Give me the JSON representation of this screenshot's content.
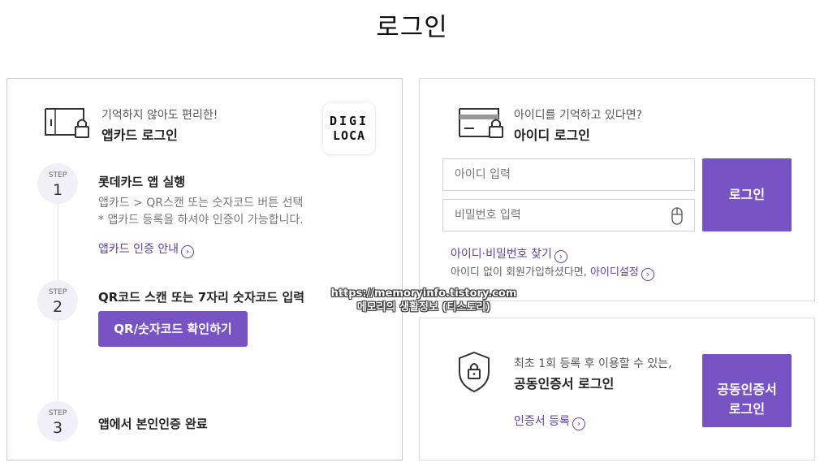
{
  "page": {
    "title": "로그인"
  },
  "app_card_panel": {
    "subtitle": "기억하지 않아도 편리한!",
    "heading": "앱카드 로그인",
    "logo": {
      "line1": "DIGI",
      "line2": "LOCA"
    },
    "step_label": "STEP",
    "steps": [
      {
        "number": "1",
        "title": "롯데카드 앱 실행",
        "desc1": "앱카드 > QR스캔 또는 숫자코드 버튼 선택",
        "desc2": "* 앱카드 등록을 하셔야 인증이 가능합니다.",
        "link": "앱카드 인증 안내"
      },
      {
        "number": "2",
        "title": "QR코드 스캔 또는 7자리 숫자코드 입력",
        "button": "QR/숫자코드 확인하기"
      },
      {
        "number": "3",
        "title": "앱에서 본인인증 완료"
      }
    ]
  },
  "id_panel": {
    "subtitle": "아이디를 기억하고 있다면?",
    "heading": "아이디 로그인",
    "id_placeholder": "아이디 입력",
    "pw_placeholder": "비밀번호 입력",
    "login_button": "로그인",
    "find_link": "아이디·비밀번호 찾기",
    "no_id_text": "아이디 없이 회원가입하셨다면,",
    "id_setup_link": "아이디설정"
  },
  "cert_panel": {
    "subtitle": "최초 1회 등록 후 이용할 수 있는,",
    "heading": "공동인증서 로그인",
    "register_link": "인증서 등록",
    "button_line1": "공동인증서",
    "button_line2": "로그인"
  },
  "watermark": {
    "line1": "https://memoryinfo.tistory.com",
    "line2": "메모리의 생활정보 (티스토리)"
  },
  "colors": {
    "accent": "#7753c3",
    "link": "#6240a8",
    "step_bg": "#f1eff8"
  },
  "icons": {
    "app_card": "phone-card-lock-icon",
    "id_card": "card-lock-icon",
    "cert": "shield-lock-icon",
    "chevron": "chevron-right-circle-icon",
    "mouse": "mouse-icon"
  }
}
